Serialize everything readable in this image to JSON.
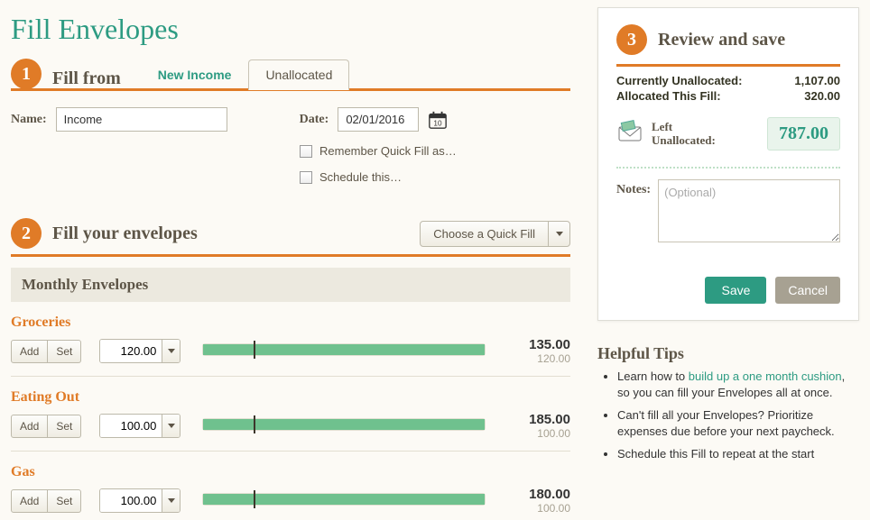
{
  "page_title": "Fill Envelopes",
  "step1": {
    "title": "Fill from",
    "tabs": {
      "new_income": "New Income",
      "unallocated": "Unallocated"
    },
    "name_label": "Name:",
    "name_value": "Income",
    "date_label": "Date:",
    "date_value": "02/01/2016",
    "remember_label": "Remember Quick Fill as…",
    "schedule_label": "Schedule this…"
  },
  "step2": {
    "title": "Fill your envelopes",
    "quickfill_label": "Choose a Quick Fill",
    "monthly_header": "Monthly Envelopes",
    "add_label": "Add",
    "set_label": "Set",
    "envelopes": [
      {
        "name": "Groceries",
        "amount": "120.00",
        "balance": "135.00",
        "prev": "120.00",
        "fill_pct": 100,
        "tick_pct": 18
      },
      {
        "name": "Eating Out",
        "amount": "100.00",
        "balance": "185.00",
        "prev": "100.00",
        "fill_pct": 100,
        "tick_pct": 18
      },
      {
        "name": "Gas",
        "amount": "100.00",
        "balance": "180.00",
        "prev": "100.00",
        "fill_pct": 100,
        "tick_pct": 18
      }
    ]
  },
  "step3": {
    "title": "Review and save",
    "currently_label": "Currently Unallocated:",
    "currently_value": "1,107.00",
    "allocated_label": "Allocated This Fill:",
    "allocated_value": "320.00",
    "left_label_1": "Left",
    "left_label_2": "Unallocated:",
    "left_value": "787.00",
    "notes_label": "Notes:",
    "notes_placeholder": "(Optional)",
    "save_label": "Save",
    "cancel_label": "Cancel"
  },
  "tips": {
    "header": "Helpful Tips",
    "items": [
      {
        "pre": "Learn how to ",
        "link": "build up a one month cushion",
        "post": ", so you can fill your Envelopes all at once."
      },
      {
        "pre": "Can't fill all your Envelopes? Prioritize expenses due before your next paycheck.",
        "link": "",
        "post": ""
      },
      {
        "pre": "Schedule this Fill to repeat at the start",
        "link": "",
        "post": ""
      }
    ]
  }
}
